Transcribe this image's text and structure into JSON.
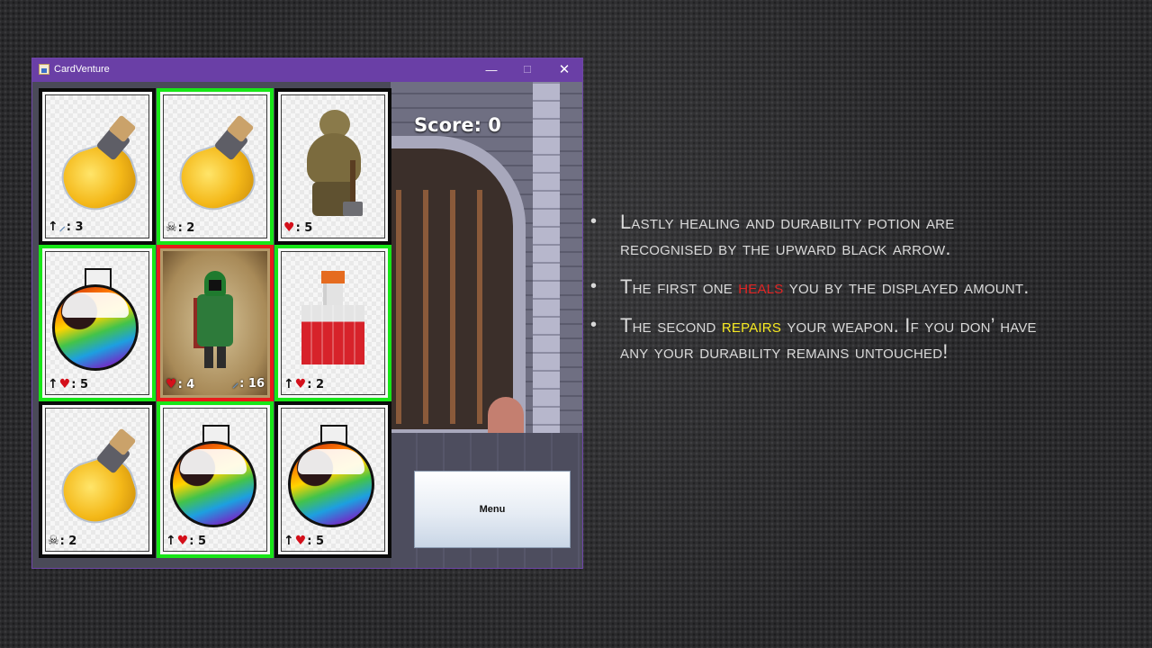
{
  "window": {
    "title": "CardVenture",
    "minimize": "—",
    "maximize": "☐",
    "close": "✕"
  },
  "game": {
    "score_label": "Score: 0",
    "menu_label": "Menu",
    "cards": [
      {
        "art": "yellow-potion-icon",
        "icon": "up-arrow-sword-icon",
        "stat": ": 3",
        "border": "black"
      },
      {
        "art": "yellow-potion-icon",
        "icon": "skull-icon",
        "stat": ": 2",
        "border": "green"
      },
      {
        "art": "troll-monster-icon",
        "icon": "heart-icon",
        "stat": ": 5",
        "border": "black"
      },
      {
        "art": "rainbow-potion-icon",
        "icon": "up-arrow-heart-icon",
        "stat": ": 5",
        "border": "green"
      },
      {
        "art": "hero-player-icon",
        "icon": "heart-icon",
        "stat": ": 4",
        "icon2": "sword-icon",
        "stat2": ": 16",
        "border": "red"
      },
      {
        "art": "red-pixel-potion-icon",
        "icon": "up-arrow-heart-icon",
        "stat": ": 2",
        "border": "green"
      },
      {
        "art": "yellow-potion-icon",
        "icon": "skull-icon",
        "stat": ": 2",
        "border": "black"
      },
      {
        "art": "rainbow-potion-icon",
        "icon": "up-arrow-heart-icon",
        "stat": ": 5",
        "border": "green"
      },
      {
        "art": "rainbow-potion-icon",
        "icon": "up-arrow-heart-icon",
        "stat": ": 5",
        "border": "black"
      }
    ]
  },
  "slide": {
    "bullet1": "Lastly healing and durability potion are recognised by the upward black arrow.",
    "bullet2_a": "The first one ",
    "bullet2_hl": "heals",
    "bullet2_b": " you by the displayed amount.",
    "bullet3_a": "The second ",
    "bullet3_hl": "repairs",
    "bullet3_b": " your weapon. If you don’ have any your durability remains untouched!",
    "colors": {
      "highlight_red": "#e02424",
      "highlight_yellow": "#f7ea22",
      "text": "#d9d9d9"
    }
  }
}
